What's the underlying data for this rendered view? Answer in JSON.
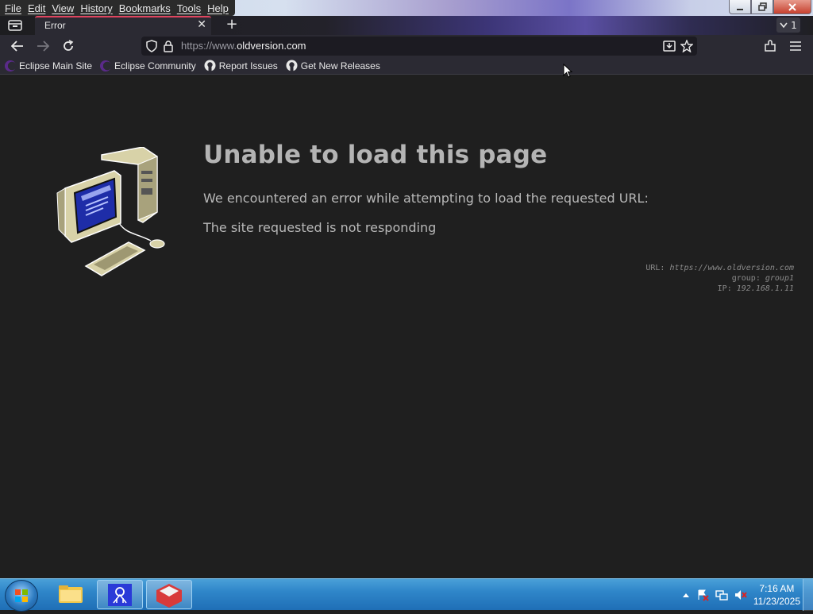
{
  "menu": [
    "File",
    "Edit",
    "View",
    "History",
    "Bookmarks",
    "Tools",
    "Help"
  ],
  "tab": {
    "title": "Error",
    "close": "✕",
    "new_tab": "+",
    "count": "1"
  },
  "url": {
    "prefix": "https://www.",
    "domain": "oldversion.com"
  },
  "bookmarks": [
    "Eclipse Main Site",
    "Eclipse Community",
    "Report Issues",
    "Get New Releases"
  ],
  "error": {
    "title": "Unable to load this page",
    "description": "We encountered an error while attempting to load the requested URL:",
    "reason": "The site requested is not responding"
  },
  "meta": {
    "url_label": "URL:",
    "url_value": "https://www.oldversion.com",
    "group_label": "group:",
    "group_value": "group1",
    "ip_label": "IP:",
    "ip_value": "192.168.1.11"
  },
  "clock": {
    "time": "7:16 AM",
    "date": "11/23/2025"
  },
  "colors": {
    "accent_tab": "#e0455f",
    "content_bg": "#1f1f1f",
    "chrome_bg": "#2b2a33"
  }
}
